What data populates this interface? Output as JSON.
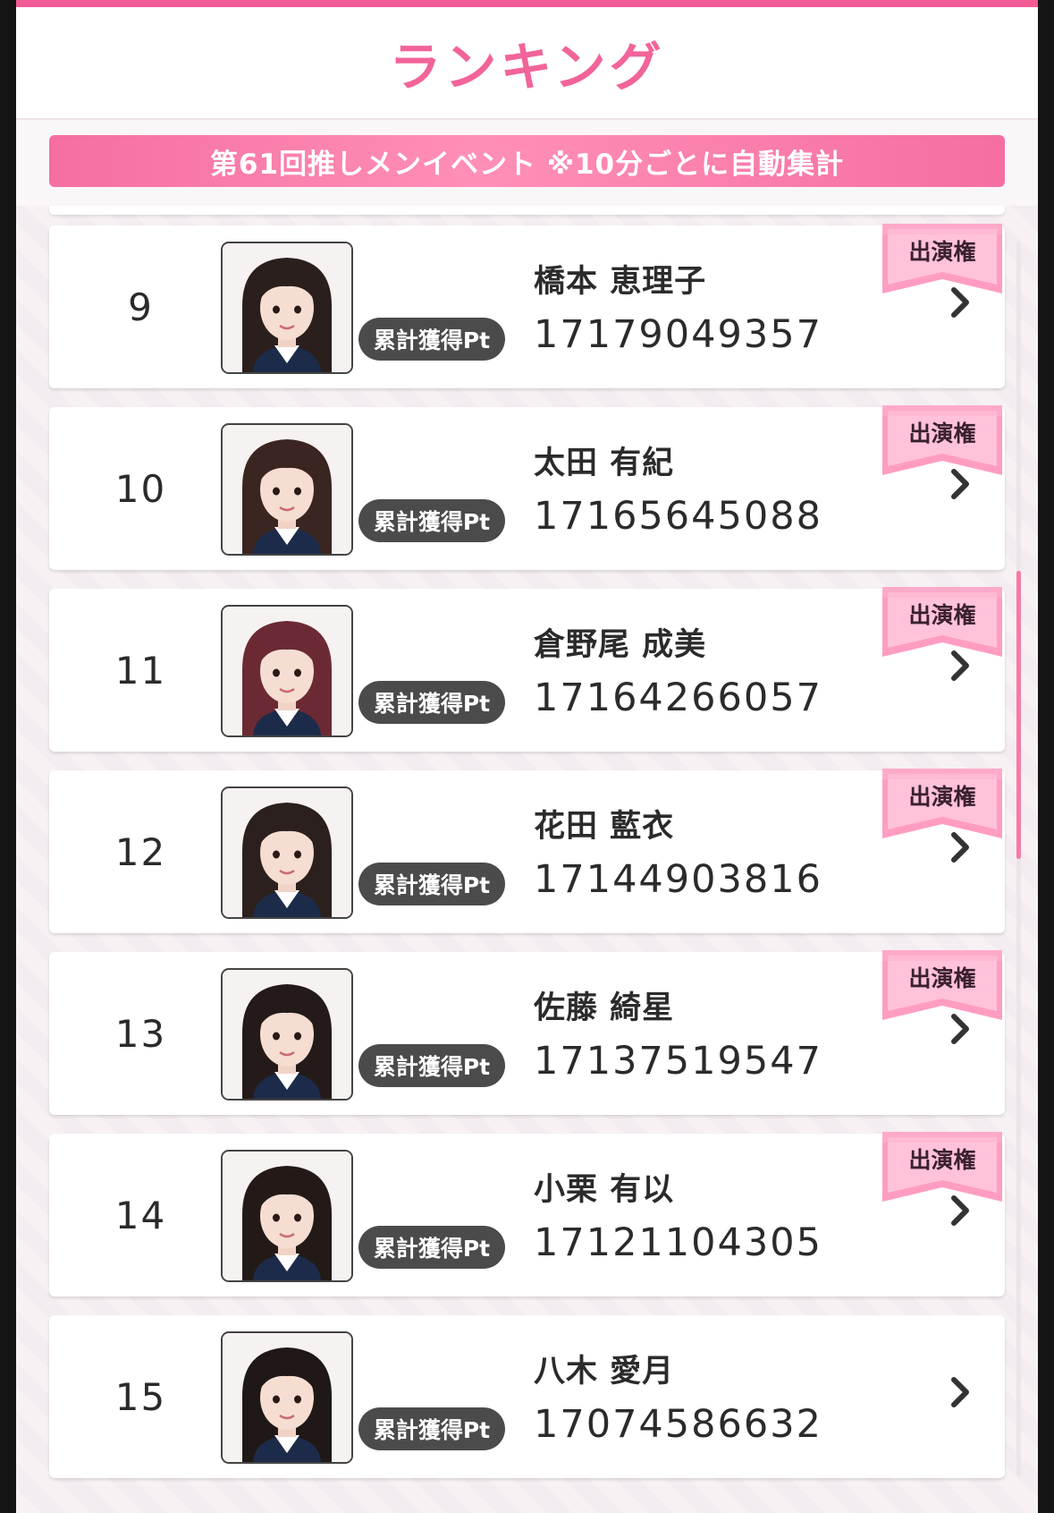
{
  "header": {
    "title": "ランキング"
  },
  "event_banner": {
    "text": "第61回推しメンイベント ※10分ごとに自動集計"
  },
  "colors": {
    "accent": "#f2649a",
    "badge_dark": "#4b4b4b",
    "perf_pink": "#ff9cc2"
  },
  "ranking": [
    {
      "rank": "9",
      "name": "橋本 恵理子",
      "pt_label": "累計獲得Pt",
      "points": "17179049357",
      "perf_badge": "出演権",
      "has_perf": true,
      "hair": "#2a1f1c"
    },
    {
      "rank": "10",
      "name": "太田 有紀",
      "pt_label": "累計獲得Pt",
      "points": "17165645088",
      "perf_badge": "出演権",
      "has_perf": true,
      "hair": "#3a2520"
    },
    {
      "rank": "11",
      "name": "倉野尾 成美",
      "pt_label": "累計獲得Pt",
      "points": "17164266057",
      "perf_badge": "出演権",
      "has_perf": true,
      "hair": "#6b2a33"
    },
    {
      "rank": "12",
      "name": "花田 藍衣",
      "pt_label": "累計獲得Pt",
      "points": "17144903816",
      "perf_badge": "出演権",
      "has_perf": true,
      "hair": "#2b201d"
    },
    {
      "rank": "13",
      "name": "佐藤 綺星",
      "pt_label": "累計獲得Pt",
      "points": "17137519547",
      "perf_badge": "出演権",
      "has_perf": true,
      "hair": "#231a19"
    },
    {
      "rank": "14",
      "name": "小栗 有以",
      "pt_label": "累計獲得Pt",
      "points": "17121104305",
      "perf_badge": "出演権",
      "has_perf": true,
      "hair": "#231a18"
    },
    {
      "rank": "15",
      "name": "八木 愛月",
      "pt_label": "累計獲得Pt",
      "points": "17074586632",
      "perf_badge": "",
      "has_perf": false,
      "hair": "#1f1817"
    }
  ]
}
